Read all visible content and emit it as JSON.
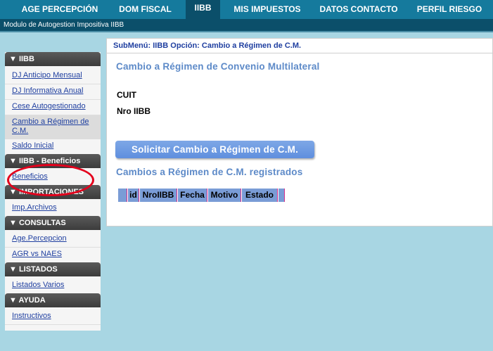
{
  "nav": {
    "items": [
      {
        "label": "AGE PERCEPCIÓN"
      },
      {
        "label": "DOM FISCAL"
      },
      {
        "label": "IIBB"
      },
      {
        "label": "MIS IMPUESTOS"
      },
      {
        "label": "DATOS CONTACTO"
      },
      {
        "label": "PERFIL RIESGO"
      }
    ],
    "active": "IIBB"
  },
  "sub_header": {
    "title": "Modulo de Autogestion Impositiva IIBB"
  },
  "sidebar": {
    "sections": [
      {
        "title": "▼ IIBB",
        "links": [
          "DJ Anticipo Mensual",
          "DJ Informativa Anual",
          "Cese Autogestionado",
          "Cambio a Régimen de C.M.",
          "Saldo Inicial"
        ]
      },
      {
        "title": "▼ IIBB - Beneficios",
        "links": [
          "Beneficios"
        ]
      },
      {
        "title": "▼ IMPORTACIONES",
        "links": [
          "Imp.Archivos"
        ]
      },
      {
        "title": "▼ CONSULTAS",
        "links": [
          "Age.Percepcion",
          "AGR vs NAES"
        ]
      },
      {
        "title": "▼ LISTADOS",
        "links": [
          "Listados Varios"
        ]
      },
      {
        "title": "▼ AYUDA",
        "links": [
          "Instructivos"
        ]
      }
    ]
  },
  "main": {
    "submenu": "SubMenú: IIBB Opción: Cambio a Régimen de C.M.",
    "title": "Cambio a Régimen de Convenio Multilateral",
    "cuit_label": "CUIT",
    "nro_iibb_label": "Nro IIBB",
    "button_label": "Solicitar Cambio a Régimen de C.M.",
    "registered_title": "Cambios a Régimen de C.M. registrados",
    "table": {
      "columns": [
        "id",
        "NroIIBB",
        "Fecha",
        "Motivo",
        "Estado"
      ]
    }
  },
  "colors": {
    "nav_bg": "#157a9d",
    "nav_active": "#0b4f6a",
    "page_bg": "#a8d6e3",
    "accent_blue": "#5d8ac8",
    "highlight_ellipse": "#e4001c"
  }
}
